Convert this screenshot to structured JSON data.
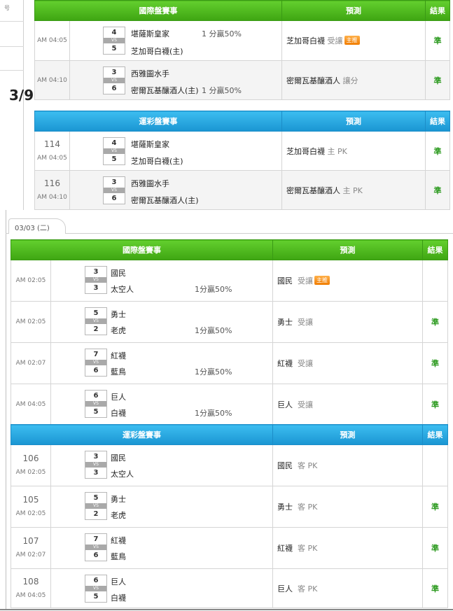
{
  "sidebar_mark": "号",
  "day_label": "3/9",
  "tab_label": "03/03 (二)",
  "sections": [
    {
      "header": [
        "國際盤賽事",
        "預測",
        "結果"
      ],
      "rows": [
        {
          "num": "",
          "time": "AM 04:05",
          "s1": "4",
          "vs": "VS",
          "s2": "5",
          "t1": "堪薩斯皇家",
          "t2": "芝加哥白襪(主)",
          "hc": "1 分贏50%",
          "hc_row": 1,
          "pred": "芝加哥白襪",
          "pred_g": "受讓",
          "badge": "主推",
          "res": "準"
        },
        {
          "num": "",
          "time": "AM 04:10",
          "s1": "3",
          "vs": "VS",
          "s2": "6",
          "t1": "西雅圖水手",
          "t2": "密爾瓦基釀酒人(主)",
          "hc": "1 分贏50%",
          "hc_row": 2,
          "pred": "密爾瓦基釀酒人",
          "pred_g": "讓分",
          "badge": "",
          "res": "準"
        }
      ]
    },
    {
      "header": [
        "運彩盤賽事",
        "預測",
        "結果"
      ],
      "rows": [
        {
          "num": "114",
          "time": "AM 04:05",
          "s1": "4",
          "vs": "VS",
          "s2": "5",
          "t1": "堪薩斯皇家",
          "t2": "芝加哥白襪(主)",
          "hc": "",
          "hc_row": 0,
          "pred": "芝加哥白襪",
          "pred_g": "主 PK",
          "badge": "",
          "res": "準"
        },
        {
          "num": "116",
          "time": "AM 04:10",
          "s1": "3",
          "vs": "VS",
          "s2": "6",
          "t1": "西雅圖水手",
          "t2": "密爾瓦基釀酒人(主)",
          "hc": "",
          "hc_row": 0,
          "pred": "密爾瓦基釀酒人",
          "pred_g": "主 PK",
          "badge": "",
          "res": "準"
        }
      ]
    },
    {
      "header": [
        "國際盤賽事",
        "預測",
        "結果"
      ],
      "rows": [
        {
          "num": "",
          "time": "AM 02:05",
          "s1": "3",
          "vs": "VS",
          "s2": "3",
          "t1": "國民",
          "t2": "太空人",
          "hc": "1分贏50%",
          "hc_row": 2,
          "pred": "國民",
          "pred_g": "受讓",
          "badge": "主推",
          "res": ""
        },
        {
          "num": "",
          "time": "AM 02:05",
          "s1": "5",
          "vs": "VS",
          "s2": "2",
          "t1": "勇士",
          "t2": "老虎",
          "hc": "1分贏50%",
          "hc_row": 2,
          "pred": "勇士",
          "pred_g": "受讓",
          "badge": "",
          "res": "準"
        },
        {
          "num": "",
          "time": "AM 02:07",
          "s1": "7",
          "vs": "VS",
          "s2": "6",
          "t1": "紅襪",
          "t2": "藍鳥",
          "hc": "1分贏50%",
          "hc_row": 2,
          "pred": "紅襪",
          "pred_g": "受讓",
          "badge": "",
          "res": "準"
        },
        {
          "num": "",
          "time": "AM 04:05",
          "s1": "6",
          "vs": "VS",
          "s2": "5",
          "t1": "巨人",
          "t2": "白襪",
          "hc": "1分贏50%",
          "hc_row": 2,
          "pred": "巨人",
          "pred_g": "受讓",
          "badge": "",
          "res": "準"
        }
      ]
    },
    {
      "header": [
        "運彩盤賽事",
        "預測",
        "結果"
      ],
      "rows": [
        {
          "num": "106",
          "time": "AM 02:05",
          "s1": "3",
          "vs": "VS",
          "s2": "3",
          "t1": "國民",
          "t2": "太空人",
          "hc": "",
          "hc_row": 0,
          "pred": "國民",
          "pred_g": "客 PK",
          "badge": "",
          "res": ""
        },
        {
          "num": "105",
          "time": "AM 02:05",
          "s1": "5",
          "vs": "VS",
          "s2": "2",
          "t1": "勇士",
          "t2": "老虎",
          "hc": "",
          "hc_row": 0,
          "pred": "勇士",
          "pred_g": "客 PK",
          "badge": "",
          "res": "準"
        },
        {
          "num": "107",
          "time": "AM 02:07",
          "s1": "7",
          "vs": "VS",
          "s2": "6",
          "t1": "紅襪",
          "t2": "藍鳥",
          "hc": "",
          "hc_row": 0,
          "pred": "紅襪",
          "pred_g": "客 PK",
          "badge": "",
          "res": "準"
        },
        {
          "num": "108",
          "time": "AM 04:05",
          "s1": "6",
          "vs": "VS",
          "s2": "5",
          "t1": "巨人",
          "t2": "白襪",
          "hc": "",
          "hc_row": 0,
          "pred": "巨人",
          "pred_g": "客 PK",
          "badge": "",
          "res": "準"
        }
      ]
    }
  ]
}
